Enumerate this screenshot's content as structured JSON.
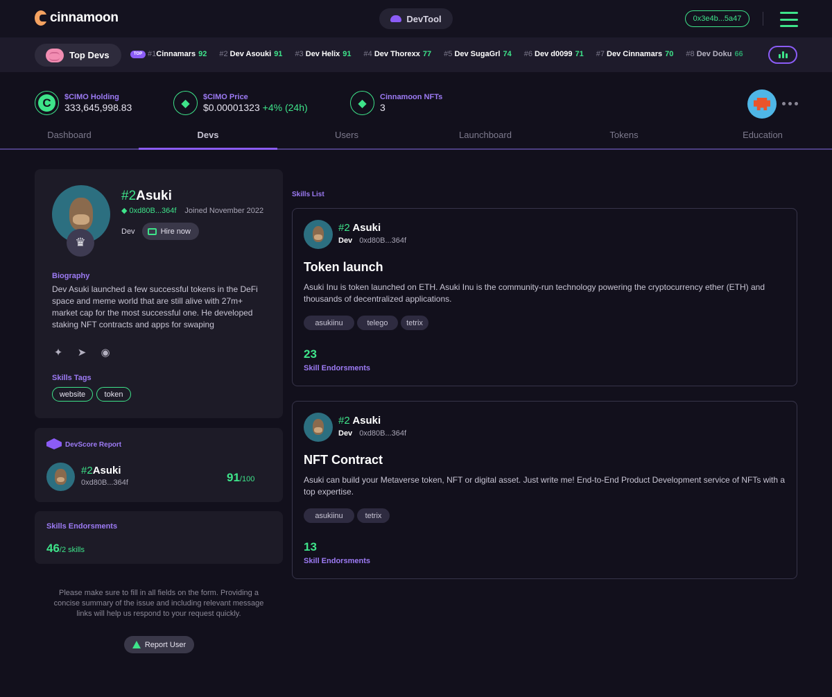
{
  "header": {
    "logo_text": "cinnamoon",
    "devtool_label": "DevTool",
    "wallet_address": "0x3e4b...5a47"
  },
  "ticker": {
    "pill_label": "Top Devs",
    "top_badge": "TOP",
    "items": [
      {
        "rank": "#1",
        "name": "Cinnamars",
        "score": "92"
      },
      {
        "rank": "#2",
        "name": "Dev Asouki",
        "score": "91"
      },
      {
        "rank": "#3",
        "name": "Dev Helix",
        "score": "91"
      },
      {
        "rank": "#4",
        "name": "Dev Thorexx",
        "score": "77"
      },
      {
        "rank": "#5",
        "name": "Dev SugaGrl",
        "score": "74"
      },
      {
        "rank": "#6",
        "name": "Dev d0099",
        "score": "71"
      },
      {
        "rank": "#7",
        "name": "Dev Cinnamars",
        "score": "70"
      },
      {
        "rank": "#8",
        "name": "Dev Doku",
        "score": "66"
      }
    ]
  },
  "stats": {
    "holding_label": "$CIMO Holding",
    "holding_value": "333,645,998.83",
    "price_label": "$CIMO Price",
    "price_value": "$0.00001323",
    "price_change": "+4% (24h)",
    "nfts_label": "Cinnamoon NFTs",
    "nfts_value": "3"
  },
  "tabs": [
    "Dashboard",
    "Devs",
    "Users",
    "Launchboard",
    "Tokens",
    "Education"
  ],
  "profile": {
    "rank": "#2",
    "name": "Asuki",
    "address": "0xd80B...364f",
    "joined": "Joined November 2022",
    "role": "Dev",
    "hire_label": "Hire now",
    "bio_label": "Biography",
    "bio": "Dev Asuki launched a few successful tokens in the DeFi space and meme world that are still alive with 27m+ market cap for the most successful one. He developed staking NFT contracts and apps for swaping",
    "skills_tags_label": "Skills Tags",
    "skills_tags": [
      "website",
      "token"
    ]
  },
  "devscore": {
    "label": "DevScore Report",
    "rank": "#2",
    "name": "Asuki",
    "address": "0xd80B...364f",
    "score": "91",
    "max": "/100"
  },
  "endorsements": {
    "label": "Skills Endorsments",
    "count": "46",
    "suffix": "/2 skills"
  },
  "notice": "Please make sure to fill in all fields on the form. Providing a concise summary of the issue and including relevant message links will help us respond to your request quickly.",
  "report_label": "Report User",
  "skills_list_label": "Skills List",
  "skills": [
    {
      "rank": "#2",
      "name": "Asuki",
      "role": "Dev",
      "address": "0xd80B...364f",
      "title": "Token launch",
      "desc": "Asuki Inu is token launched on ETH. Asuki Inu is the community-run technology powering the cryptocurrency ether (ETH) and thousands of decentralized applications.",
      "tags": [
        "asukiinu",
        "telego",
        "tetrix"
      ],
      "count": "23",
      "count_label": "Skill Endorsments"
    },
    {
      "rank": "#2",
      "name": "Asuki",
      "role": "Dev",
      "address": "0xd80B...364f",
      "title": "NFT Contract",
      "desc": "Asuki can build your Metaverse token, NFT or digital asset. Just write me! End-to-End Product Development service of NFTs with a top expertise.",
      "tags": [
        "asukiinu",
        "tetrix"
      ],
      "count": "13",
      "count_label": "Skill Endorsments"
    }
  ],
  "colors": {
    "background": "#12101c",
    "accent_green": "#3ee48a",
    "accent_purple": "#8b5cf6",
    "label_purple": "#9d7bf5",
    "card": "#1d1b27"
  }
}
